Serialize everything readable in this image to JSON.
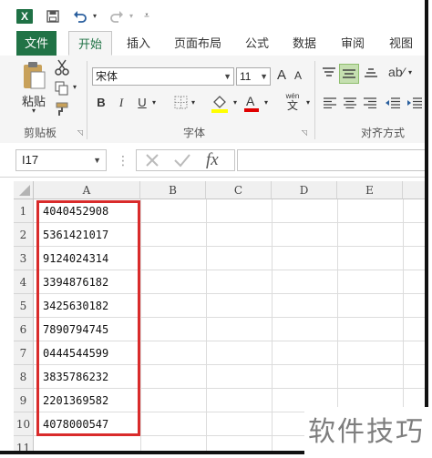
{
  "quick_access": {
    "app_icon": "X",
    "save_icon": "save-icon",
    "undo_icon": "undo-icon",
    "redo_icon": "redo-icon",
    "customize_icon": "customize-qat-icon"
  },
  "tabs": [
    "文件",
    "开始",
    "插入",
    "页面布局",
    "公式",
    "数据",
    "审阅",
    "视图"
  ],
  "active_tab": "开始",
  "clipboard": {
    "paste_label": "粘贴",
    "group_label": "剪贴板"
  },
  "font": {
    "name": "宋体",
    "size": "11",
    "bold": "B",
    "italic": "I",
    "underline": "U",
    "group_label": "字体",
    "grow": "A",
    "shrink": "A",
    "wen": "wén",
    "wen_char": "文"
  },
  "alignment": {
    "group_label": "对齐方式"
  },
  "formula_bar": {
    "name_box": "I17",
    "fx": "fx",
    "value": ""
  },
  "columns": [
    "A",
    "B",
    "C",
    "D",
    "E"
  ],
  "rows": [
    {
      "num": "1",
      "a": "4040452908"
    },
    {
      "num": "2",
      "a": "5361421017"
    },
    {
      "num": "3",
      "a": "9124024314"
    },
    {
      "num": "4",
      "a": "3394876182"
    },
    {
      "num": "5",
      "a": "3425630182"
    },
    {
      "num": "6",
      "a": "7890794745"
    },
    {
      "num": "7",
      "a": "0444544599"
    },
    {
      "num": "8",
      "a": "3835786232"
    },
    {
      "num": "9",
      "a": "2201369582"
    },
    {
      "num": "10",
      "a": "4078000547"
    },
    {
      "num": "11",
      "a": ""
    }
  ],
  "watermark": "软件技巧",
  "colors": {
    "excel_green": "#217346",
    "highlight_red": "#d92b2b"
  }
}
